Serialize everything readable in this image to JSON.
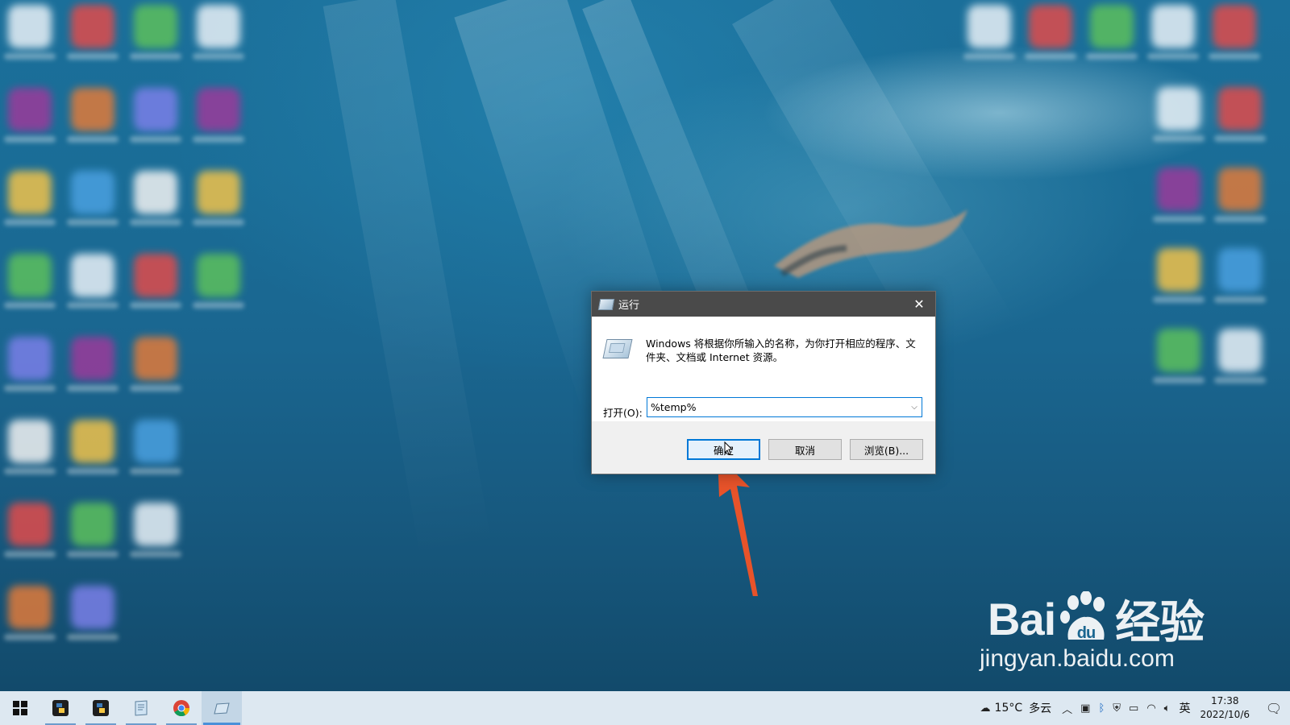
{
  "dialog": {
    "title": "运行",
    "close_glyph": "✕",
    "description": "Windows 将根据你所输入的名称，为你打开相应的程序、文件夹、文档或 Internet 资源。",
    "open_label": "打开(O):",
    "open_value": "%temp%",
    "buttons": {
      "ok": "确定",
      "cancel": "取消",
      "browse": "浏览(B)..."
    }
  },
  "watermark": {
    "logo_left": "Bai",
    "logo_du": "du",
    "logo_cn": "经验",
    "url": "jingyan.baidu.com"
  },
  "taskbar": {
    "apps": [
      {
        "icon": "windows-start-icon",
        "glyph": "⊞"
      },
      {
        "icon": "python-icon",
        "glyph": ""
      },
      {
        "icon": "python-icon",
        "glyph": ""
      },
      {
        "icon": "notepad-icon",
        "glyph": ""
      },
      {
        "icon": "chrome-icon",
        "glyph": ""
      },
      {
        "icon": "run-icon",
        "glyph": ""
      }
    ],
    "weather_temp": "15°C",
    "weather_desc": "多云",
    "ime": "英",
    "time": "17:38",
    "date": "2022/10/6"
  },
  "colors": {
    "accent": "#0078d7",
    "arrow": "#e8532a",
    "titlebar": "#4a4a4a",
    "taskbar": "#dde8f1"
  }
}
